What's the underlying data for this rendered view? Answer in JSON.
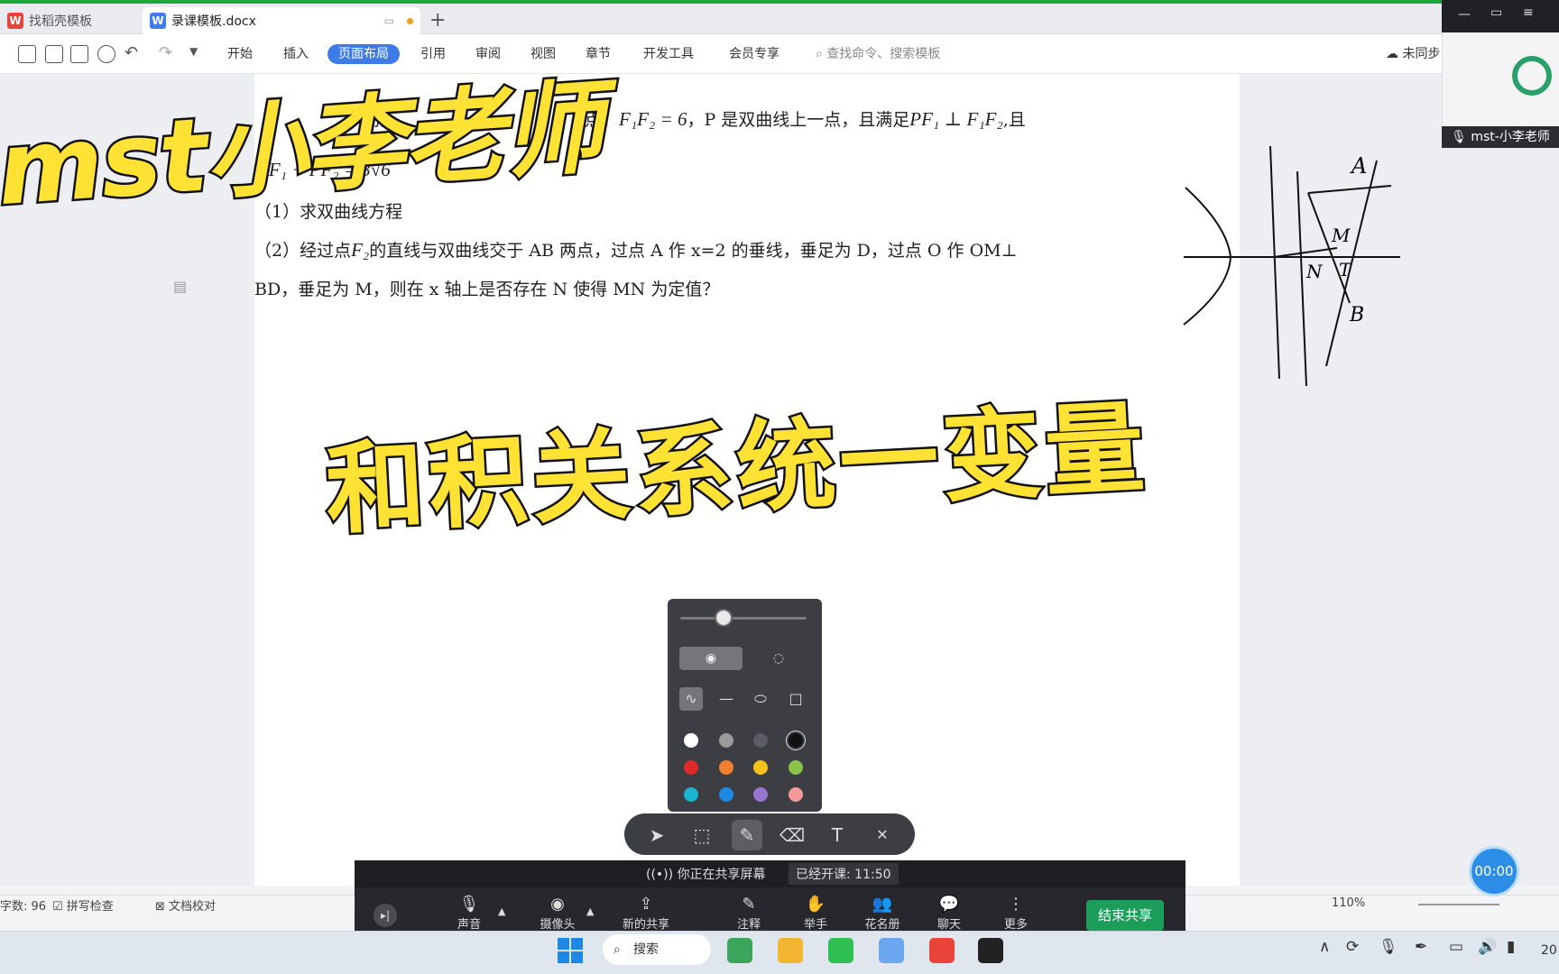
{
  "tabs": [
    {
      "label": "找稻壳模板",
      "icon": "wps-logo-icon"
    },
    {
      "label": "录课模板.docx",
      "icon": "word-doc-icon"
    }
  ],
  "menu": [
    "开始",
    "插入",
    "页面布局",
    "引用",
    "审阅",
    "视图",
    "章节",
    "开发工具",
    "会员专享"
  ],
  "command_search": "查找命令、搜索模板",
  "sync_status": "未同步",
  "document": {
    "line1_mid": "点，",
    "line1_eq": "F₁F₂ = 6",
    "line1_text": "，P 是双曲线上一点，且满足",
    "line1_cond": "PF₁ ⊥ F₁F₂",
    "line1_end": ",且",
    "fragment_1": "别",
    "line2_eq": "PF₁ + PF₂ = 3√6",
    "question1": "（1）求双曲线方程",
    "question2_start": "（2）经过点",
    "question2_f2": "F₂",
    "question2_rest": "的直线与双曲线交于 AB 两点，过点 A 作 x=2 的垂线，垂足为 D，过点 O 作 OM⊥",
    "question2_line2": "BD，垂足为 M，则在 x 轴上是否存在 N 使得 MN 为定值？"
  },
  "overlay": {
    "teacher_brand": "mst小李老师",
    "topic": "和积关系统一变量"
  },
  "camera": {
    "name": "mst-小李老师"
  },
  "sketch_labels": [
    "A",
    "M",
    "N",
    "T",
    "B"
  ],
  "meeting": {
    "share_status": "你正在共享屏幕",
    "class_time": "已经开课: 11:50",
    "tools": [
      "声音",
      "摄像头",
      "新的共享",
      "注释",
      "举手",
      "花名册",
      "聊天",
      "更多"
    ],
    "end_share": "结束共享"
  },
  "statusbar": {
    "word_count": "字数: 96",
    "spell_check": "拼写检查",
    "doc_proof": "文档校对",
    "zoom": "110%"
  },
  "timer": "00:00",
  "taskbar": {
    "search": "搜索",
    "clock_fragment": "20"
  },
  "colors": {
    "accent": "#3d7be8",
    "brand_yellow": "#ffe234",
    "end_share_green": "#1c9e5a",
    "swatches": [
      "#ffffff",
      "#9a9a9a",
      "#5a5c66",
      "#111111",
      "#e02a2a",
      "#f08030",
      "#f5c21a",
      "#8bc34a",
      "#18b4d0",
      "#1e88e5",
      "#9575cd",
      "#f49a9a"
    ]
  }
}
